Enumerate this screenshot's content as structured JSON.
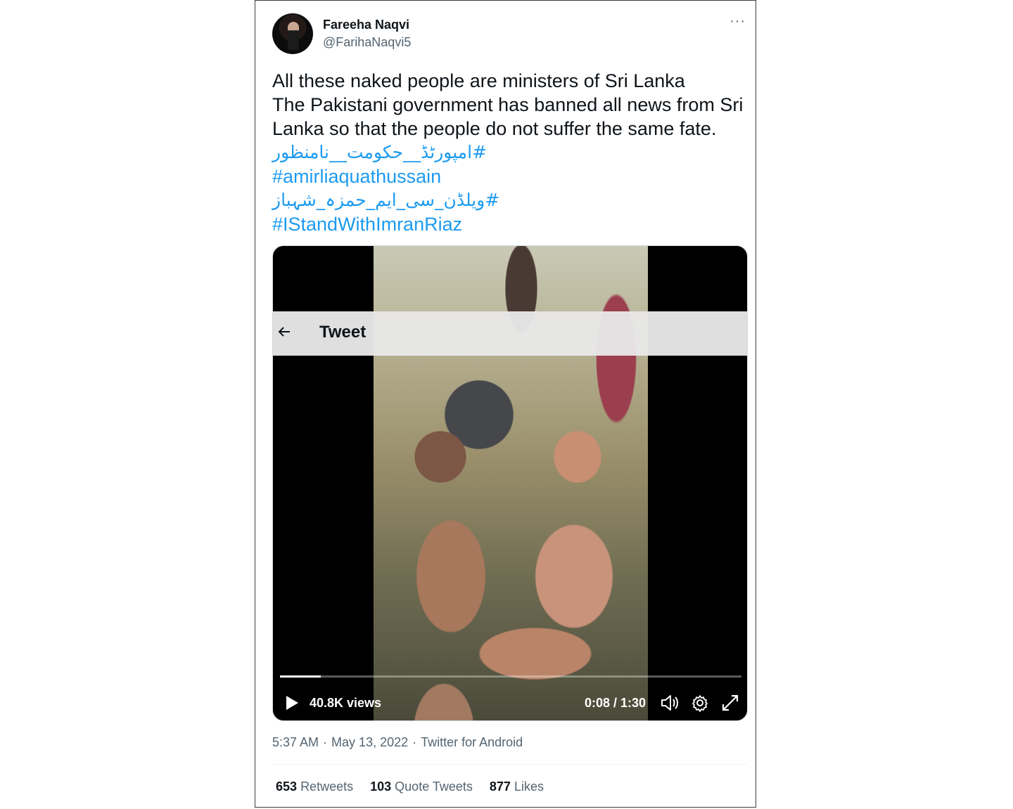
{
  "author": {
    "name": "Fareeha Naqvi",
    "handle": "@FarihaNaqvi5"
  },
  "more_label": "···",
  "tweet": {
    "lines": [
      "All these naked people are ministers of Sri Lanka",
      "The Pakistani government has banned all news from Sri Lanka so that the people do not suffer the same fate."
    ],
    "hashtags": [
      "#امپورٹڈ__حکومت__نامنظور",
      "#amirliaquathussain",
      "#ویلڈن_سی_ایم_حمزہ_شہباز",
      "#IStandWithImranRiaz"
    ]
  },
  "video": {
    "overlay_title": "Tweet",
    "views": "40.8K views",
    "time": "0:08 / 1:30",
    "progress": 0.088
  },
  "meta": {
    "time": "5:37 AM",
    "date": "May 13, 2022",
    "source": "Twitter for Android",
    "separator": "·"
  },
  "stats": {
    "retweets_count": "653",
    "retweets_label": "Retweets",
    "quotes_count": "103",
    "quotes_label": "Quote Tweets",
    "likes_count": "877",
    "likes_label": "Likes"
  },
  "icons": [
    "more-icon",
    "back-arrow-icon",
    "play-icon",
    "volume-icon",
    "gear-icon",
    "fullscreen-icon"
  ]
}
